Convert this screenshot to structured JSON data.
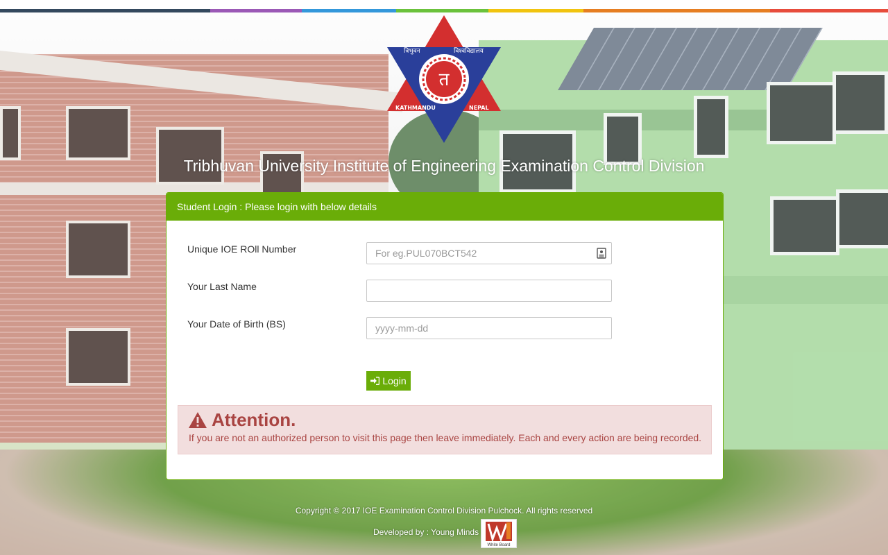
{
  "stripe_colors": [
    "#34495e",
    "#9b59b6",
    "#3498db",
    "#6bc23c",
    "#f1c40f",
    "#e67e22",
    "#e74c3c"
  ],
  "logo": {
    "text_top_left": "त्रिभुवन",
    "text_top_right": "विश्वविद्यालय",
    "text_bottom_left": "KATHMANDU",
    "text_bottom_right": "NEPAL",
    "emblem": "त"
  },
  "page_title": "Tribhuvan University Institute of Engineering Examination Control Division",
  "panel": {
    "heading": "Student Login : Please login with below details",
    "roll_label": "Unique IOE ROll Number",
    "roll_placeholder": "For eg.PUL070BCT542",
    "lastname_label": "Your Last Name",
    "dob_label": "Your Date of Birth (BS)",
    "dob_placeholder": "yyyy-mm-dd",
    "login_label": "Login"
  },
  "alert": {
    "title": "Attention.",
    "message": "If you are not an authorized person to visit this page then leave immediately. Each and every action are being recorded."
  },
  "footer": {
    "copyright": "Copyright © 2017 IOE Examination Control Division Pulchock. All rights reserved",
    "developed": "Developed by : Young Minds",
    "badge_text": "White Board"
  },
  "colors": {
    "accent": "#6aad08",
    "alert_text": "#a94442",
    "alert_bg": "#f2dede"
  },
  "icons": {
    "login": "sign-in-icon",
    "warning": "warning-triangle-icon",
    "id": "id-card-icon"
  }
}
